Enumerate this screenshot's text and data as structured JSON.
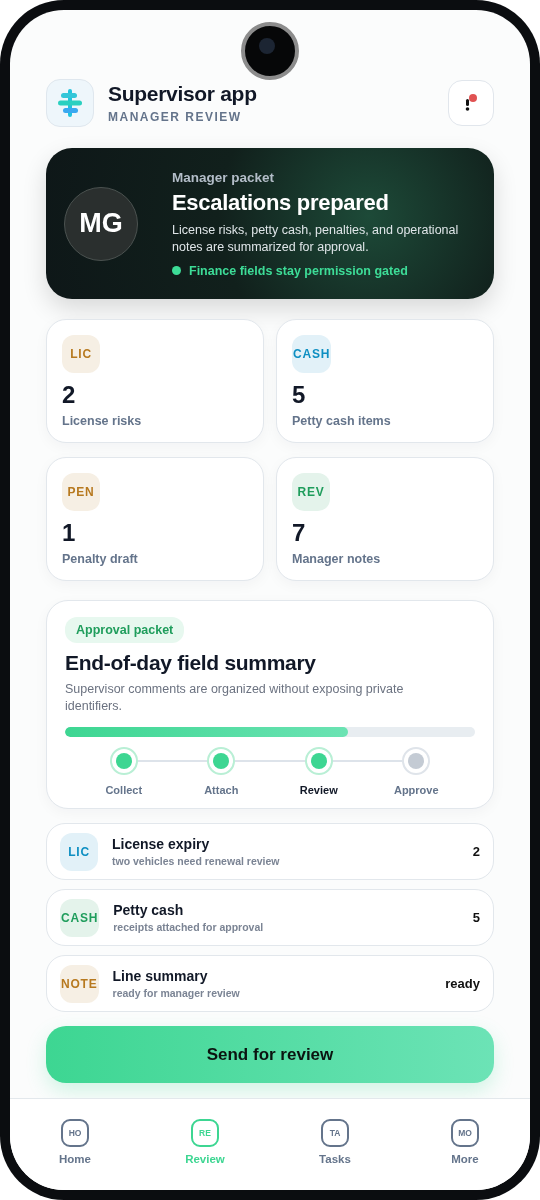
{
  "header": {
    "title": "Supervisor app",
    "subtitle": "MANAGER REVIEW",
    "has_alert": true
  },
  "hero": {
    "avatar": "MG",
    "eyebrow": "Manager packet",
    "title": "Escalations prepared",
    "body": "License risks, petty cash, penalties, and operational notes are summarized for approval.",
    "status": "Finance fields stay permission gated"
  },
  "stats": [
    {
      "tag": "LIC",
      "color": "#b7791f",
      "value": "2",
      "label": "License risks"
    },
    {
      "tag": "CASH",
      "color": "#0e8fc2",
      "value": "5",
      "label": "Petty cash items"
    },
    {
      "tag": "PEN",
      "color": "#b7791f",
      "value": "1",
      "label": "Penalty draft"
    },
    {
      "tag": "REV",
      "color": "#1f9d5c",
      "value": "7",
      "label": "Manager notes"
    }
  ],
  "approval": {
    "badge": "Approval packet",
    "title": "End-of-day field summary",
    "body": "Supervisor comments are organized without exposing private identifiers.",
    "level": 0.69,
    "steps": [
      {
        "label": "Collect",
        "done": true,
        "selected": false
      },
      {
        "label": "Attach",
        "done": true,
        "selected": false
      },
      {
        "label": "Review",
        "done": true,
        "selected": true
      },
      {
        "label": "Approve",
        "done": false,
        "selected": false
      }
    ]
  },
  "items": [
    {
      "tag": "LIC",
      "color": "#0e8fc2",
      "title": "License expiry",
      "detail": "two vehicles need renewal review",
      "value": "2"
    },
    {
      "tag": "CASH",
      "color": "#1f9d5c",
      "title": "Petty cash",
      "detail": "receipts attached for approval",
      "value": "5"
    },
    {
      "tag": "NOTE",
      "color": "#b7791f",
      "title": "Line summary",
      "detail": "ready for manager review",
      "value": "ready"
    }
  ],
  "action": "Send for review",
  "nav": [
    {
      "icon": "HO",
      "label": "Home",
      "selected": false
    },
    {
      "icon": "RE",
      "label": "Review",
      "selected": true
    },
    {
      "icon": "TA",
      "label": "Tasks",
      "selected": false
    },
    {
      "icon": "MO",
      "label": "More",
      "selected": false
    }
  ]
}
